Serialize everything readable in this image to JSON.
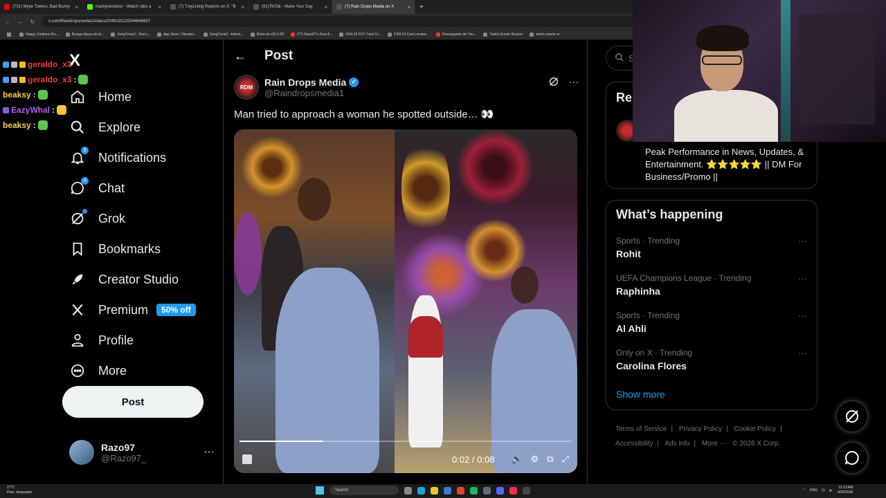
{
  "browser": {
    "tabs": [
      {
        "label": "(731) Myke Towers, Bad Bunny",
        "color": "#ff0000",
        "active": false
      },
      {
        "label": "markynestdoor - Watch clips a",
        "color": "#53fc18",
        "active": false
      },
      {
        "label": "(7) TreyLiving Reports on X: \"B",
        "color": "#ffffff",
        "active": false
      },
      {
        "label": "(91)TikTok - Make Your Day",
        "color": "#ffffff",
        "active": false
      },
      {
        "label": "(7) Rain Drops Media on X",
        "color": "#ffffff",
        "active": true
      }
    ],
    "url": "x.com/Raindropsmedia1/status/2049193125344649607",
    "bookmarks": [
      "Happy Cristiano Ro...",
      "Burago figura de te...",
      "SongTrivia2 - Test y...",
      "App Store / Streami...",
      "SongTrivia2 - Admin...",
      "Rotocob v26.0.28",
      "(77) Razo97's Zest-A...",
      "FIFA 23 FUT Card Cr...",
      "FIFA 23 Card creator...",
      "Descargador de You...",
      "Twitch Emote Resizer",
      "twitch emote re"
    ]
  },
  "chat": [
    {
      "name": "geraldo_x3",
      "color": "#e83f3f"
    },
    {
      "name": "geraldo_x3",
      "sep": ":",
      "color": "#e83f3f"
    },
    {
      "name": "beaksy",
      "sep": ":",
      "color": "#f5d547"
    },
    {
      "name": "EazyWhal",
      "sep": ":",
      "color": "#b25ff0"
    },
    {
      "name": "beaksy",
      "sep": ":",
      "color": "#f5d547"
    }
  ],
  "nav": {
    "logo": "X",
    "items": [
      {
        "label": "Home",
        "icon": "home-icon"
      },
      {
        "label": "Explore",
        "icon": "search-icon"
      },
      {
        "label": "Notifications",
        "icon": "bell-icon",
        "badge": "3"
      },
      {
        "label": "Chat",
        "icon": "chat-icon",
        "badge": "4"
      },
      {
        "label": "Grok",
        "icon": "grok-icon"
      },
      {
        "label": "Bookmarks",
        "icon": "bookmark-icon"
      },
      {
        "label": "Creator Studio",
        "icon": "rocket-icon"
      },
      {
        "label": "Premium",
        "icon": "x-icon",
        "promo": "50% off"
      },
      {
        "label": "Profile",
        "icon": "person-icon"
      },
      {
        "label": "More",
        "icon": "more-circle-icon"
      }
    ],
    "post_button": "Post",
    "profile": {
      "name": "Razo97",
      "handle": "@Razo97_",
      "more": "···"
    }
  },
  "post": {
    "header_title": "Post",
    "author_name": "Rain Drops Media",
    "author_handle": "@Raindropsmedia1",
    "avatar_text": "RDM",
    "text": "Man tried to approach a woman he spotted outside… 👀",
    "video": {
      "time": "0:02 / 0:08",
      "progress": 0.25
    }
  },
  "right": {
    "search_placeholder": "Se",
    "relevant_title": "Rel",
    "relevant_bio": "Peak Performance in News, Updates, & Entertainment. ⭐⭐⭐⭐⭐ || DM For Business/Promo ||",
    "happening_title": "What’s happening",
    "trends": [
      {
        "meta": "Sports · Trending",
        "name": "Rohit"
      },
      {
        "meta": "UEFA Champions League · Trending",
        "name": "Raphinha"
      },
      {
        "meta": "Sports · Trending",
        "name": "Al Ahli"
      },
      {
        "meta": "Only on X · Trending",
        "name": "Carolina Flores"
      }
    ],
    "show_more": "Show more",
    "footer": [
      "Terms of Service",
      "|",
      "Privacy Policy",
      "|",
      "Cookie Policy",
      "|",
      "Accessibility",
      "|",
      "Ads info",
      "|",
      "More ···",
      "© 2026 X Corp."
    ]
  },
  "taskbar": {
    "weather_temp": "27°C",
    "weather_desc": "Prac. despejado",
    "search": "Search",
    "lang": "ENG",
    "time": "12:13 AM",
    "date": "4/30/2026"
  },
  "colors": {
    "accent": "#1d9bf0",
    "bg": "#000000",
    "border": "#2f3336",
    "muted": "#71767b"
  }
}
